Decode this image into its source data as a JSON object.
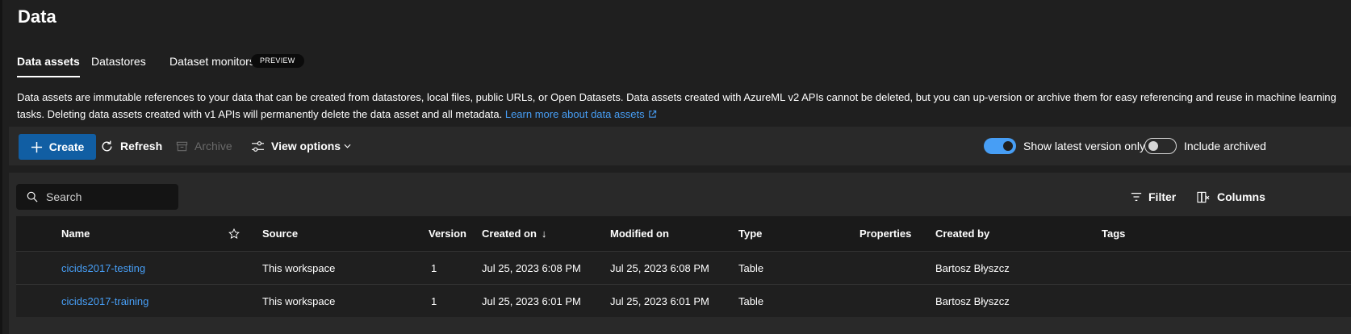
{
  "page": {
    "title": "Data"
  },
  "tabs": [
    {
      "label": "Data assets",
      "active": true
    },
    {
      "label": "Datastores",
      "active": false
    },
    {
      "label": "Dataset monitors",
      "active": false,
      "badge": "PREVIEW"
    }
  ],
  "description": {
    "text": "Data assets are immutable references to your data that can be created from datastores, local files, public URLs, or Open Datasets. Data assets created with AzureML v2 APIs cannot be deleted, but you can up-version or archive them for easy referencing and reuse in machine learning tasks. Deleting data assets created with v1 APIs will permanently delete the data asset and all metadata. ",
    "link": "Learn more about data assets"
  },
  "toolbar": {
    "create": "Create",
    "refresh": "Refresh",
    "archive": "Archive",
    "view_options": "View options",
    "show_latest": {
      "label": "Show latest version only",
      "on": true
    },
    "include_archived": {
      "label": "Include archived",
      "on": false
    }
  },
  "grid": {
    "search_placeholder": "Search",
    "filter": "Filter",
    "columns_button": "Columns",
    "headers": {
      "name": "Name",
      "source": "Source",
      "version": "Version",
      "created_on": "Created on",
      "sort_arrow": "↓",
      "modified_on": "Modified on",
      "type": "Type",
      "properties": "Properties",
      "created_by": "Created by",
      "tags": "Tags"
    },
    "rows": [
      {
        "name": "cicids2017-testing",
        "source": "This workspace",
        "version": "1",
        "created_on": "Jul 25, 2023 6:08 PM",
        "modified_on": "Jul 25, 2023 6:08 PM",
        "type": "Table",
        "properties": "",
        "created_by": "Bartosz Błyszcz",
        "tags": ""
      },
      {
        "name": "cicids2017-training",
        "source": "This workspace",
        "version": "1",
        "created_on": "Jul 25, 2023 6:01 PM",
        "modified_on": "Jul 25, 2023 6:01 PM",
        "type": "Table",
        "properties": "",
        "created_by": "Bartosz Błyszcz",
        "tags": ""
      }
    ]
  },
  "colors": {
    "accent": "#115ea3",
    "link": "#479ef5",
    "background": "#1f1f1f",
    "panel": "#292929"
  }
}
